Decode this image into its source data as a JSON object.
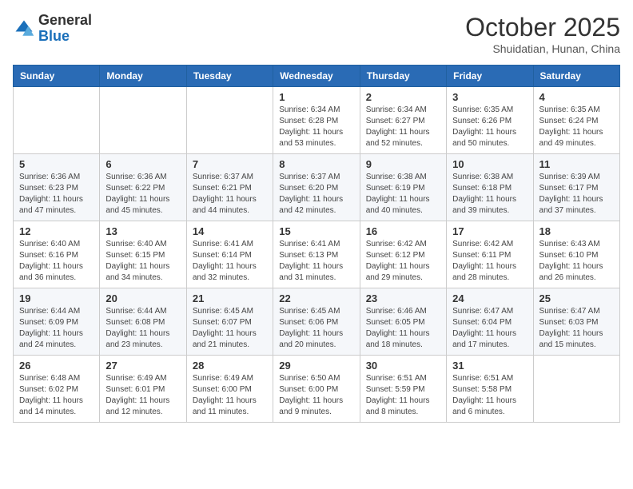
{
  "header": {
    "logo_general": "General",
    "logo_blue": "Blue",
    "month_title": "October 2025",
    "subtitle": "Shuidatian, Hunan, China"
  },
  "days_of_week": [
    "Sunday",
    "Monday",
    "Tuesday",
    "Wednesday",
    "Thursday",
    "Friday",
    "Saturday"
  ],
  "weeks": [
    [
      {
        "day": "",
        "info": ""
      },
      {
        "day": "",
        "info": ""
      },
      {
        "day": "",
        "info": ""
      },
      {
        "day": "1",
        "info": "Sunrise: 6:34 AM\nSunset: 6:28 PM\nDaylight: 11 hours and 53 minutes."
      },
      {
        "day": "2",
        "info": "Sunrise: 6:34 AM\nSunset: 6:27 PM\nDaylight: 11 hours and 52 minutes."
      },
      {
        "day": "3",
        "info": "Sunrise: 6:35 AM\nSunset: 6:26 PM\nDaylight: 11 hours and 50 minutes."
      },
      {
        "day": "4",
        "info": "Sunrise: 6:35 AM\nSunset: 6:24 PM\nDaylight: 11 hours and 49 minutes."
      }
    ],
    [
      {
        "day": "5",
        "info": "Sunrise: 6:36 AM\nSunset: 6:23 PM\nDaylight: 11 hours and 47 minutes."
      },
      {
        "day": "6",
        "info": "Sunrise: 6:36 AM\nSunset: 6:22 PM\nDaylight: 11 hours and 45 minutes."
      },
      {
        "day": "7",
        "info": "Sunrise: 6:37 AM\nSunset: 6:21 PM\nDaylight: 11 hours and 44 minutes."
      },
      {
        "day": "8",
        "info": "Sunrise: 6:37 AM\nSunset: 6:20 PM\nDaylight: 11 hours and 42 minutes."
      },
      {
        "day": "9",
        "info": "Sunrise: 6:38 AM\nSunset: 6:19 PM\nDaylight: 11 hours and 40 minutes."
      },
      {
        "day": "10",
        "info": "Sunrise: 6:38 AM\nSunset: 6:18 PM\nDaylight: 11 hours and 39 minutes."
      },
      {
        "day": "11",
        "info": "Sunrise: 6:39 AM\nSunset: 6:17 PM\nDaylight: 11 hours and 37 minutes."
      }
    ],
    [
      {
        "day": "12",
        "info": "Sunrise: 6:40 AM\nSunset: 6:16 PM\nDaylight: 11 hours and 36 minutes."
      },
      {
        "day": "13",
        "info": "Sunrise: 6:40 AM\nSunset: 6:15 PM\nDaylight: 11 hours and 34 minutes."
      },
      {
        "day": "14",
        "info": "Sunrise: 6:41 AM\nSunset: 6:14 PM\nDaylight: 11 hours and 32 minutes."
      },
      {
        "day": "15",
        "info": "Sunrise: 6:41 AM\nSunset: 6:13 PM\nDaylight: 11 hours and 31 minutes."
      },
      {
        "day": "16",
        "info": "Sunrise: 6:42 AM\nSunset: 6:12 PM\nDaylight: 11 hours and 29 minutes."
      },
      {
        "day": "17",
        "info": "Sunrise: 6:42 AM\nSunset: 6:11 PM\nDaylight: 11 hours and 28 minutes."
      },
      {
        "day": "18",
        "info": "Sunrise: 6:43 AM\nSunset: 6:10 PM\nDaylight: 11 hours and 26 minutes."
      }
    ],
    [
      {
        "day": "19",
        "info": "Sunrise: 6:44 AM\nSunset: 6:09 PM\nDaylight: 11 hours and 24 minutes."
      },
      {
        "day": "20",
        "info": "Sunrise: 6:44 AM\nSunset: 6:08 PM\nDaylight: 11 hours and 23 minutes."
      },
      {
        "day": "21",
        "info": "Sunrise: 6:45 AM\nSunset: 6:07 PM\nDaylight: 11 hours and 21 minutes."
      },
      {
        "day": "22",
        "info": "Sunrise: 6:45 AM\nSunset: 6:06 PM\nDaylight: 11 hours and 20 minutes."
      },
      {
        "day": "23",
        "info": "Sunrise: 6:46 AM\nSunset: 6:05 PM\nDaylight: 11 hours and 18 minutes."
      },
      {
        "day": "24",
        "info": "Sunrise: 6:47 AM\nSunset: 6:04 PM\nDaylight: 11 hours and 17 minutes."
      },
      {
        "day": "25",
        "info": "Sunrise: 6:47 AM\nSunset: 6:03 PM\nDaylight: 11 hours and 15 minutes."
      }
    ],
    [
      {
        "day": "26",
        "info": "Sunrise: 6:48 AM\nSunset: 6:02 PM\nDaylight: 11 hours and 14 minutes."
      },
      {
        "day": "27",
        "info": "Sunrise: 6:49 AM\nSunset: 6:01 PM\nDaylight: 11 hours and 12 minutes."
      },
      {
        "day": "28",
        "info": "Sunrise: 6:49 AM\nSunset: 6:00 PM\nDaylight: 11 hours and 11 minutes."
      },
      {
        "day": "29",
        "info": "Sunrise: 6:50 AM\nSunset: 6:00 PM\nDaylight: 11 hours and 9 minutes."
      },
      {
        "day": "30",
        "info": "Sunrise: 6:51 AM\nSunset: 5:59 PM\nDaylight: 11 hours and 8 minutes."
      },
      {
        "day": "31",
        "info": "Sunrise: 6:51 AM\nSunset: 5:58 PM\nDaylight: 11 hours and 6 minutes."
      },
      {
        "day": "",
        "info": ""
      }
    ]
  ]
}
